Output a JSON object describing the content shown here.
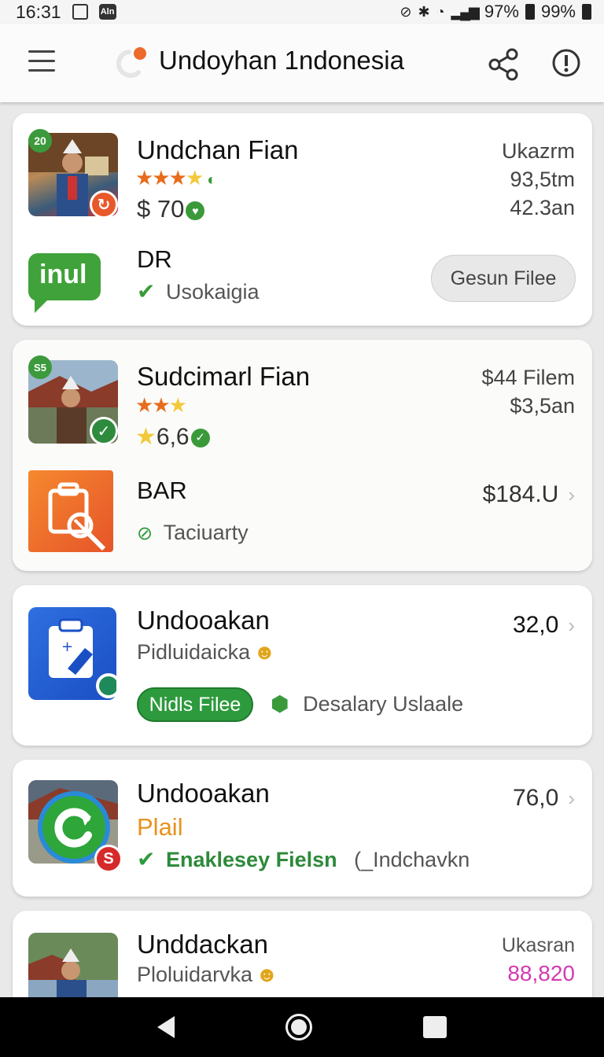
{
  "status_bar": {
    "time": "16:31",
    "mini_icon_text": "Aln",
    "battery_1": "97%",
    "battery_2": "99%"
  },
  "app_bar": {
    "title": "Undoyhan 1ndonesia"
  },
  "cards": [
    {
      "thumb_badge": "20",
      "name": "Undchan Fian",
      "price": "$ 70",
      "right_lines": [
        "Ukazrm",
        "93,5tm",
        "42.3an"
      ],
      "sub_title": "DR",
      "sub_status": "Usokaigia",
      "logo_text": "inul",
      "button": "Gesun Filee"
    },
    {
      "thumb_badge": "S5",
      "name": "Sudcimarl Fian",
      "rating": "6,6",
      "right_lines": [
        "$44 Filem",
        "$3,5an"
      ],
      "sub_title": "BAR",
      "sub_status": "Taciuarty",
      "sub_price": "$184.U"
    },
    {
      "name": "Undooakan",
      "sub": "Pidluidaicka",
      "right_value": "32,0",
      "button": "Nidls Filee",
      "tag": "Desalary Uslaale"
    },
    {
      "name": "Undooakan",
      "sub_orange": "Plail",
      "right_value": "76,0",
      "status": "Enaklesey Fielsn",
      "extra": "(_Indchavkn",
      "badge": "S"
    },
    {
      "name": "Unddackan",
      "sub": "Ploluidarvka",
      "right_lines": [
        "Ukasran",
        "88,820"
      ]
    }
  ]
}
